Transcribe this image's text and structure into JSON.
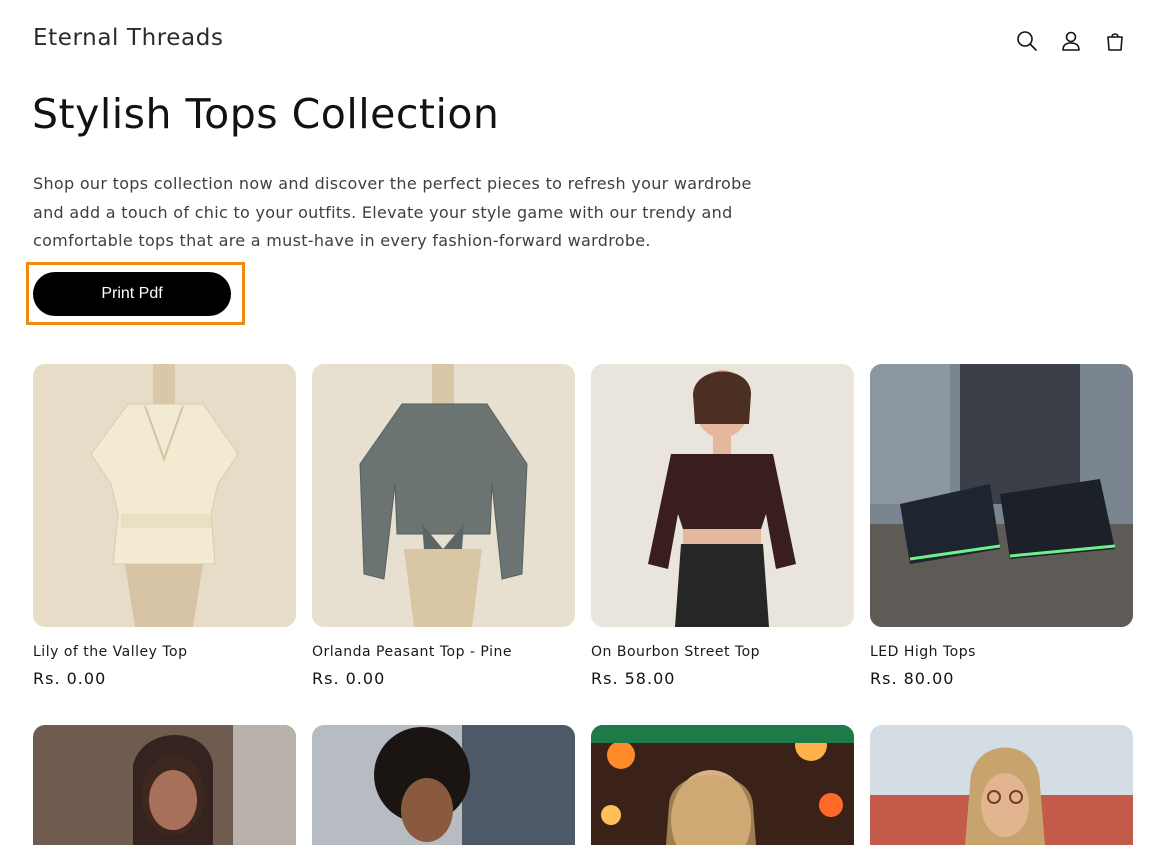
{
  "header": {
    "brand": "Eternal Threads",
    "icons": [
      "search-icon",
      "account-icon",
      "cart-icon"
    ]
  },
  "collection": {
    "title": "Stylish Tops Collection",
    "description": "Shop our tops collection now and discover the perfect pieces to refresh your wardrobe and add a touch of chic to your outfits. Elevate your style game with our trendy and comfortable tops that are a must-have in every fashion-forward wardrobe.",
    "print_button": "Print Pdf"
  },
  "products": [
    {
      "name": "Lily of the Valley Top",
      "price": "Rs. 0.00"
    },
    {
      "name": "Orlanda Peasant Top - Pine",
      "price": "Rs. 0.00"
    },
    {
      "name": "On Bourbon Street Top",
      "price": "Rs. 58.00"
    },
    {
      "name": "LED High Tops",
      "price": "Rs. 80.00"
    }
  ],
  "colors": {
    "highlight": "#f08a10",
    "button": "#000000"
  }
}
